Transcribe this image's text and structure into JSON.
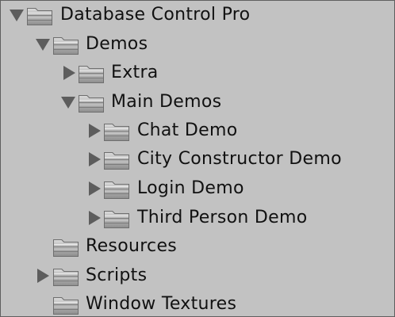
{
  "tree": {
    "items": [
      {
        "label": "Database Control Pro",
        "icon": "folder-icon",
        "arrow": "expanded"
      },
      {
        "label": "Demos",
        "icon": "folder-icon",
        "arrow": "expanded"
      },
      {
        "label": "Extra",
        "icon": "folder-icon",
        "arrow": "collapsed"
      },
      {
        "label": "Main Demos",
        "icon": "folder-icon",
        "arrow": "expanded"
      },
      {
        "label": "Chat Demo",
        "icon": "folder-icon",
        "arrow": "collapsed"
      },
      {
        "label": "City Constructor Demo",
        "icon": "folder-icon",
        "arrow": "collapsed"
      },
      {
        "label": "Login Demo",
        "icon": "folder-icon",
        "arrow": "collapsed"
      },
      {
        "label": "Third Person Demo",
        "icon": "folder-icon",
        "arrow": "collapsed"
      },
      {
        "label": "Resources",
        "icon": "folder-icon",
        "arrow": "none"
      },
      {
        "label": "Scripts",
        "icon": "folder-icon",
        "arrow": "collapsed"
      },
      {
        "label": "Window Textures",
        "icon": "folder-icon",
        "arrow": "none"
      }
    ]
  },
  "colors": {
    "background": "#c2c2c2",
    "text": "#111111",
    "arrow": "#5d5d5d",
    "folder_body": "#a9a9a9"
  }
}
